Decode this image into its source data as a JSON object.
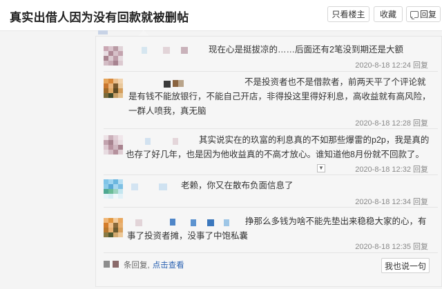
{
  "header": {
    "title": "真实出借人因为没有回款就被删帖",
    "buttons": {
      "only_op": "只看楼主",
      "favorite": "收藏",
      "reply": "回复"
    }
  },
  "comments": [
    {
      "lines": [
        "现在心是挺拔凉的……后面还有2笔没到期还是大额"
      ],
      "time": "2020-8-18 12:24",
      "action": "回复"
    },
    {
      "lines": [
        "不是投资者也不是借款者，前两天平了个评论就",
        "是有钱不能放银行，不能自己开店，非得投这里得好利息，高收益就有高风险，",
        "一群人喷我，真无脑"
      ],
      "time": "2020-8-18 12:28",
      "action": "回复"
    },
    {
      "lines": [
        "其实说实在的玖富的利息真的不如那些爆雷的p2p，我是真的",
        "也存了好几年，也是因为他收益真的不高才放心。谁知道他8月份就不回款了。"
      ],
      "time": "2020-8-18 12:32",
      "action": "回复"
    },
    {
      "lines": [
        "老赖，你又在散布负面信息了"
      ],
      "time": "2020-8-18 12:34",
      "action": "回复"
    },
    {
      "lines": [
        "挣那么多钱为啥不能先垫出来稳稳大家的心，有",
        "事了投资者摊，没事了中饱私囊"
      ],
      "time": "2020-8-18 12:35",
      "action": "回复"
    }
  ],
  "footer": {
    "more_text": "条回复,",
    "more_link": "点击查看",
    "say_button": "我也说一句"
  },
  "icons": {
    "collapse": "chevron-down-icon",
    "reply": "speech-bubble-icon"
  },
  "colors": {
    "link": "#2d64b3",
    "panel": "#f6f6f6",
    "timestamp": "#888888"
  }
}
